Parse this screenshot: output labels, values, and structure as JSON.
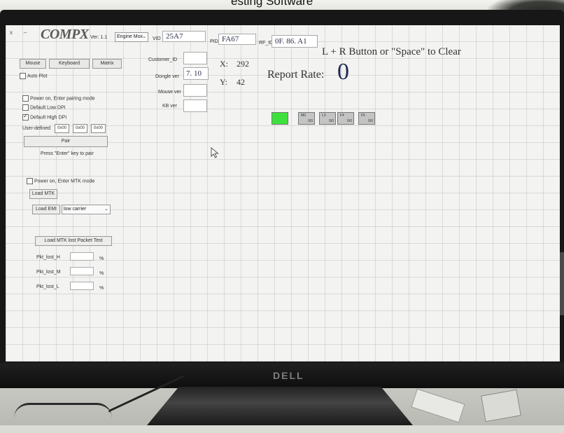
{
  "photo": {
    "room_text": "esting Software",
    "monitor_brand": "DELL"
  },
  "app": {
    "logo": "COMPX",
    "version": "Ver: 1.1",
    "engine_select": "Engine Mox",
    "vid": {
      "label": "VID",
      "value": "25A7"
    },
    "pid": {
      "label": "PID",
      "value": "FA67"
    },
    "rf_id": {
      "label": "RF_ID",
      "value": "0F. 86. A1"
    },
    "clear_hint": "L + R Button or \"Space\" to Clear"
  },
  "tabs": [
    {
      "label": "Mouse"
    },
    {
      "label": "Keyboard"
    },
    {
      "label": "Matrix"
    }
  ],
  "left": {
    "auto_plot": "Auto Plot",
    "power_on_pair": "Power on, Enter pairing mode",
    "default_low_dpi": "Default Low DPI",
    "default_high_dpi": "Default High DPI",
    "user_defined_label": "User-defined",
    "user_defined_values": [
      "0x00",
      "0x00",
      "0x00"
    ],
    "pair_button": "Pair",
    "pair_hint": "Press \"Enter\" key to pair",
    "power_on_mtk": "Power on, Enter MTK mode",
    "load_mtk": "Load MTK",
    "load_emi": "Load EMI",
    "emi_select": "low carrier",
    "load_mtk_lost": "Load MTK lost Packet Test",
    "pkt_rows": [
      {
        "label": "Pkt_lost_H",
        "unit": "%"
      },
      {
        "label": "Pkt_lost_M",
        "unit": "%"
      },
      {
        "label": "Pkt_lost_L",
        "unit": "%"
      }
    ]
  },
  "info": {
    "customer_id": "Customer_ID",
    "dongle_ver_label": "Dongle ver",
    "dongle_ver_value": "7. 10",
    "mouse_ver": "Mouse ver",
    "kb_ver": "KB ver"
  },
  "coords": {
    "x_label": "X:",
    "x_value": "292",
    "y_label": "Y:",
    "y_value": "42"
  },
  "report_rate": {
    "label": "Report Rate:",
    "value": "0"
  },
  "buttons": [
    {
      "name": "",
      "count": "",
      "color": "#3ee03e"
    },
    {
      "name": "M0",
      "count": "0/0",
      "color": "#c4c4c4"
    },
    {
      "name": "L3",
      "count": "0/0",
      "color": "#c4c4c4"
    },
    {
      "name": "F4",
      "count": "0/0",
      "color": "#c4c4c4"
    },
    {
      "name": "F5",
      "count": "0/0",
      "color": "#c4c4c4"
    }
  ]
}
